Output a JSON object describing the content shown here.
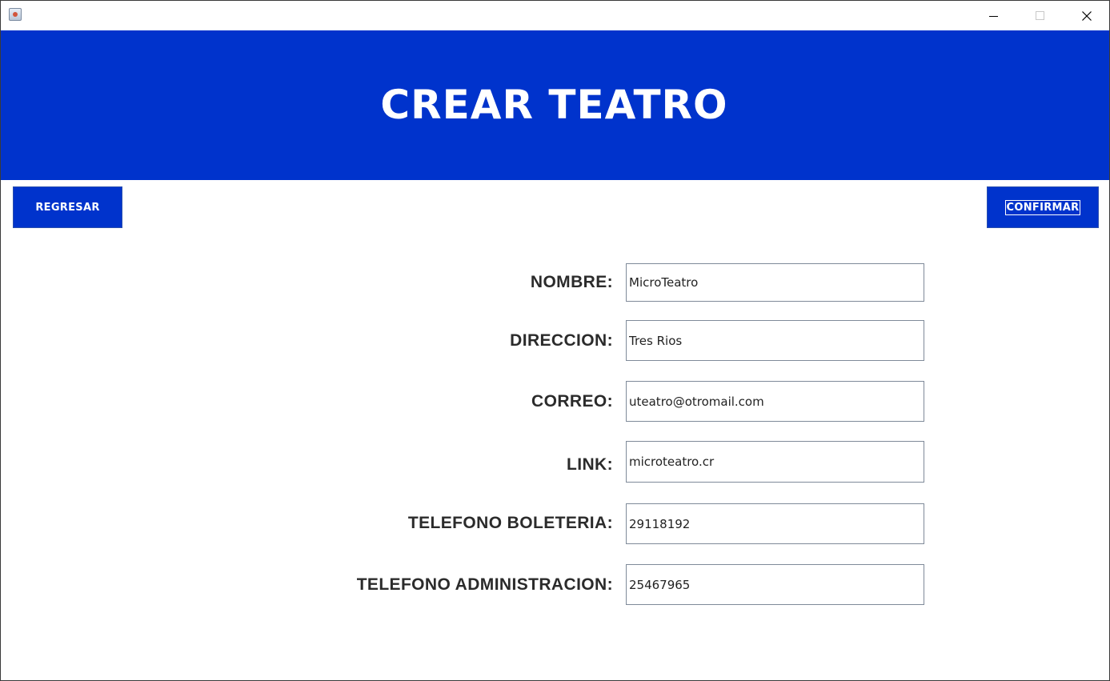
{
  "window": {
    "title": ""
  },
  "header": {
    "title": "CREAR TEATRO",
    "background_color": "#0033cc"
  },
  "actions": {
    "back_label": "REGRESAR",
    "confirm_label": "CONFIRMAR"
  },
  "form": {
    "fields": [
      {
        "label": "NOMBRE:",
        "value": "MicroTeatro"
      },
      {
        "label": "DIRECCION:",
        "value": "Tres Rios"
      },
      {
        "label": "CORREO:",
        "value": "uteatro@otromail.com"
      },
      {
        "label": "LINK:",
        "value": "microteatro.cr"
      },
      {
        "label": "TELEFONO BOLETERIA:",
        "value": "29118192"
      },
      {
        "label": "TELEFONO ADMINISTRACION:",
        "value": "25467965"
      }
    ]
  },
  "icons": {
    "app": "java-app-icon",
    "minimize": "minimize-icon",
    "maximize": "maximize-icon",
    "close": "close-icon"
  }
}
